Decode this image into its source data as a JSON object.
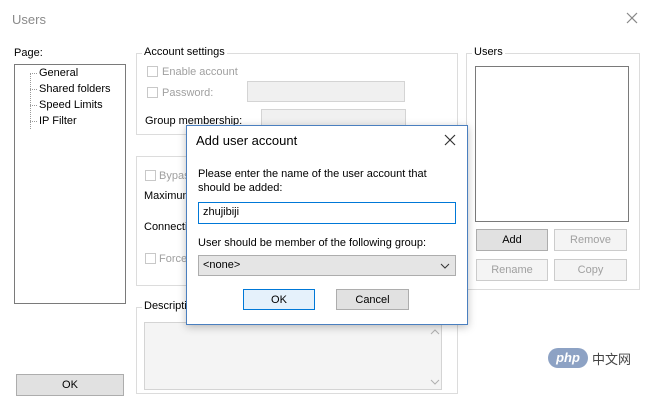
{
  "window": {
    "title": "Users"
  },
  "page_panel": {
    "label": "Page:",
    "items": [
      "General",
      "Shared folders",
      "Speed Limits",
      "IP Filter"
    ],
    "ok_label": "OK"
  },
  "account_settings": {
    "label": "Account settings",
    "enable_account": "Enable account",
    "password": "Password:",
    "group_membership": "Group membership:"
  },
  "options_panel": {
    "bypass": "Bypas",
    "maximum": "Maximum",
    "connections": "Connecti",
    "force": "Force"
  },
  "description_panel": {
    "label": "Descriptio"
  },
  "users_panel": {
    "label": "Users",
    "add_label": "Add",
    "remove_label": "Remove",
    "rename_label": "Rename",
    "copy_label": "Copy"
  },
  "dialog": {
    "title": "Add user account",
    "prompt": "Please enter the name of the user account that should be added:",
    "username_value": "zhujibiji",
    "group_prompt": "User should be member of the following group:",
    "group_selected": "<none>",
    "ok_label": "OK",
    "cancel_label": "Cancel"
  },
  "watermark": {
    "logo_text": "php",
    "site_text": "中文网"
  }
}
